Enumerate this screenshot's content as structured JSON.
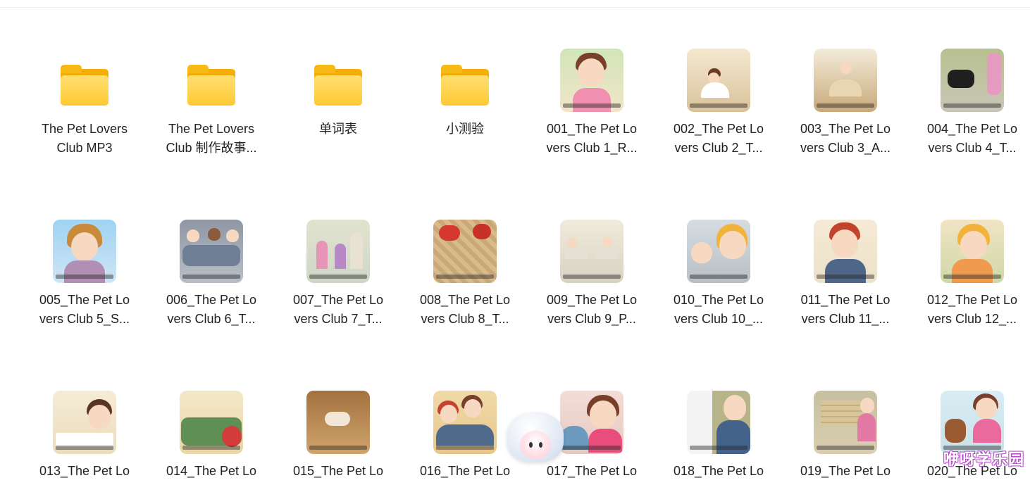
{
  "items": [
    {
      "type": "folder",
      "icon": "folder-icon",
      "line1": "The Pet Lovers",
      "line2": "Club MP3"
    },
    {
      "type": "folder",
      "icon": "folder-icon",
      "line1": "The Pet Lovers",
      "line2": "Club 制作故事..."
    },
    {
      "type": "folder",
      "icon": "folder-icon",
      "line1": "单词表",
      "line2": ""
    },
    {
      "type": "folder",
      "icon": "folder-icon",
      "line1": "小测验",
      "line2": ""
    },
    {
      "type": "video",
      "line1": "001_The Pet Lo",
      "line2": "vers Club 1_R...",
      "thumb": "girl-closeup"
    },
    {
      "type": "video",
      "line1": "002_The Pet Lo",
      "line2": "vers Club 2_T...",
      "thumb": "kitchen"
    },
    {
      "type": "video",
      "line1": "003_The Pet Lo",
      "line2": "vers Club 3_A...",
      "thumb": "dining"
    },
    {
      "type": "video",
      "line1": "004_The Pet Lo",
      "line2": "vers Club 4_T...",
      "thumb": "cat-street"
    },
    {
      "type": "video",
      "line1": "005_The Pet Lo",
      "line2": "vers Club 5_S...",
      "thumb": "grandma"
    },
    {
      "type": "video",
      "line1": "006_The Pet Lo",
      "line2": "vers Club 6_T...",
      "thumb": "group-sitting"
    },
    {
      "type": "video",
      "line1": "007_The Pet Lo",
      "line2": "vers Club 7_T...",
      "thumb": "kids-walking"
    },
    {
      "type": "video",
      "line1": "008_The Pet Lo",
      "line2": "vers Club 8_T...",
      "thumb": "parrots"
    },
    {
      "type": "video",
      "line1": "009_The Pet Lo",
      "line2": "vers Club 9_P...",
      "thumb": "classroom"
    },
    {
      "type": "video",
      "line1": "010_The Pet Lo",
      "line2": "vers Club 10_...",
      "thumb": "two-kids"
    },
    {
      "type": "video",
      "line1": "011_The Pet Lo",
      "line2": "vers Club 11_...",
      "thumb": "boy-writing"
    },
    {
      "type": "video",
      "line1": "012_The Pet Lo",
      "line2": "vers Club 12_...",
      "thumb": "girl-drawing"
    },
    {
      "type": "video",
      "line1": "013_The Pet Lo",
      "line2": "",
      "thumb": "girl-desk"
    },
    {
      "type": "video",
      "line1": "014_The Pet Lo",
      "line2": "",
      "thumb": "sofa-reading"
    },
    {
      "type": "video",
      "line1": "015_The Pet Lo",
      "line2": "",
      "thumb": "dog-under-table"
    },
    {
      "type": "video",
      "line1": "016_The Pet Lo",
      "line2": "",
      "thumb": "family"
    },
    {
      "type": "video",
      "line1": "017_The Pet Lo",
      "line2": "",
      "thumb": "girls-scarves"
    },
    {
      "type": "video",
      "line1": "018_The Pet Lo",
      "line2": "",
      "thumb": "old-man"
    },
    {
      "type": "video",
      "line1": "019_The Pet Lo",
      "line2": "",
      "thumb": "shop-window"
    },
    {
      "type": "video",
      "line1": "020_The Pet Lo",
      "line2": "",
      "thumb": "girl-with-dog"
    }
  ],
  "colors": {
    "folder": "#ffc933",
    "text": "#222222",
    "watermark": "#b04fc4"
  },
  "mascot": {
    "icon": "cloud-mascot-icon"
  },
  "watermark": "咿呀学乐园"
}
